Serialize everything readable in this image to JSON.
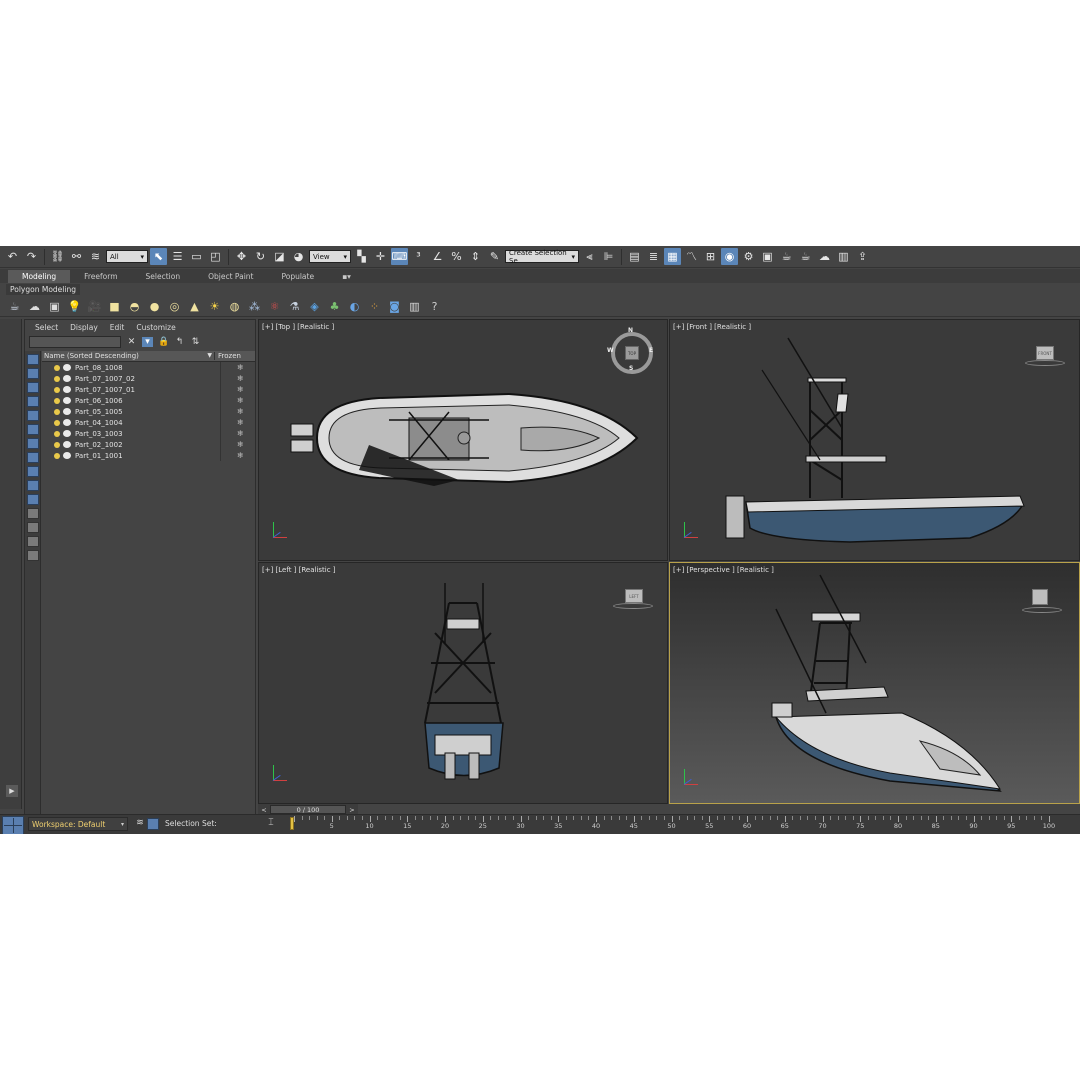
{
  "toolbar": {
    "selection_filter": "All",
    "reference_coord": "View",
    "named_selection": "Create Selection Se"
  },
  "ribbon": {
    "tabs": [
      {
        "label": "Modeling",
        "active": true
      },
      {
        "label": "Freeform",
        "active": false
      },
      {
        "label": "Selection",
        "active": false
      },
      {
        "label": "Object Paint",
        "active": false
      },
      {
        "label": "Populate",
        "active": false
      }
    ],
    "panel_label": "Polygon Modeling"
  },
  "scene_explorer": {
    "menu": [
      "Select",
      "Display",
      "Edit",
      "Customize"
    ],
    "column_name": "Name (Sorted Descending)",
    "column_frozen": "Frozen",
    "items": [
      "Part_08_1008",
      "Part_07_1007_02",
      "Part_07_1007_01",
      "Part_06_1006",
      "Part_05_1005",
      "Part_04_1004",
      "Part_03_1003",
      "Part_02_1002",
      "Part_01_1001"
    ]
  },
  "viewports": {
    "top": {
      "label": "[+] [Top ] [Realistic ]",
      "compass": {
        "n": "N",
        "s": "S",
        "e": "E",
        "w": "W",
        "cube": "TOP"
      }
    },
    "front": {
      "label": "[+] [Front ] [Realistic ]",
      "cube": "FRONT"
    },
    "left": {
      "label": "[+] [Left ] [Realistic ]",
      "cube": "LEFT"
    },
    "perspective": {
      "label": "[+] [Perspective ] [Realistic ]"
    }
  },
  "timeslider": {
    "frame_display": "0 / 100",
    "prev": "<",
    "next": ">",
    "current": 0,
    "labels": [
      "0",
      "5",
      "10",
      "15",
      "20",
      "25",
      "30",
      "35",
      "40",
      "45",
      "50",
      "55",
      "60",
      "65",
      "70",
      "75",
      "80",
      "85",
      "90",
      "95",
      "100"
    ]
  },
  "status": {
    "workspace": "Workspace: Default",
    "selection_set": "Selection Set:"
  },
  "colors": {
    "ui_bg": "#444444",
    "viewport_bg": "#3a3a3a",
    "accent": "#5b86b8",
    "active_viewport_border": "#b9a24a",
    "workspace_text": "#f0d070",
    "hull_blue": "#3c5873"
  }
}
